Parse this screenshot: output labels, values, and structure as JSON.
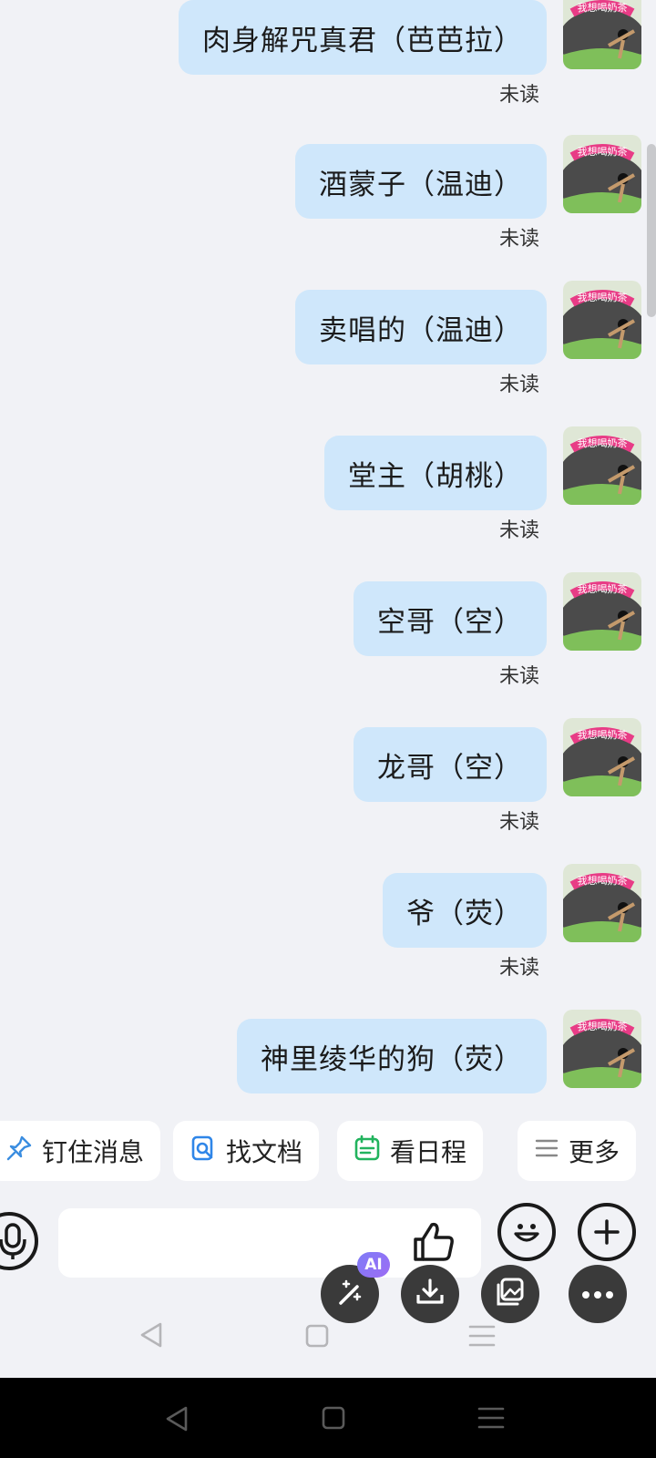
{
  "messages": [
    {
      "text": "肉身解咒真君（芭芭拉）",
      "status": "未读"
    },
    {
      "text": "酒蒙子（温迪）",
      "status": "未读"
    },
    {
      "text": "卖唱的（温迪）",
      "status": "未读"
    },
    {
      "text": "堂主（胡桃）",
      "status": "未读"
    },
    {
      "text": "空哥（空）",
      "status": "未读"
    },
    {
      "text": "龙哥（空）",
      "status": "未读"
    },
    {
      "text": "爷（荧）",
      "status": "未读"
    },
    {
      "text": "神里绫华的狗（荧）",
      "status": ""
    }
  ],
  "avatar": {
    "caption": "我想喝奶茶"
  },
  "quick_actions": {
    "pin": "钉住消息",
    "find_doc": "找文档",
    "schedule": "看日程",
    "more": "更多"
  },
  "composer": {
    "input_value": "",
    "ai_badge": "AI"
  },
  "icons": {
    "pin": "pin-icon",
    "find_doc": "search-doc-icon",
    "schedule": "calendar-icon",
    "more": "menu-icon",
    "voice": "microphone-icon",
    "like": "thumbs-up-icon",
    "emoji": "emoji-icon",
    "add": "plus-icon",
    "ai": "magic-wand-icon",
    "download": "download-icon",
    "gallery": "image-icon",
    "overflow": "more-dots-icon"
  },
  "colors": {
    "bubble": "#cfe7fb",
    "background": "#f1f2f6",
    "fab": "#3a3a3a",
    "ai_badge": "#8b74f6"
  }
}
